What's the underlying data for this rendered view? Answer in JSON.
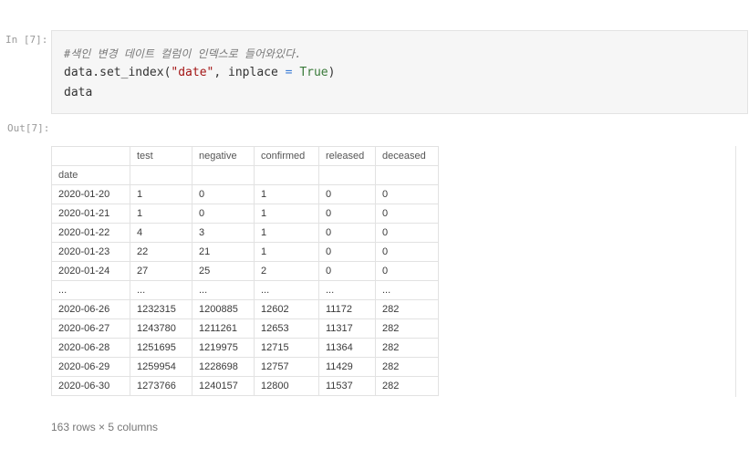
{
  "input_prompt": "In [7]:",
  "output_prompt": "Out[7]:",
  "code": {
    "comment": "#색인 변경 데이트 컬럼이 인덱스로 들어와있다.",
    "line1": {
      "prefix": "data.set_index(",
      "string": "\"date\"",
      "middle": ", inplace ",
      "operator": "=",
      "space": " ",
      "keyword": "True",
      "suffix": ")"
    },
    "line2": "data"
  },
  "table": {
    "columns": [
      "test",
      "negative",
      "confirmed",
      "released",
      "deceased"
    ],
    "index_name": "date",
    "rows": [
      [
        "2020-01-20",
        "1",
        "0",
        "1",
        "0",
        "0"
      ],
      [
        "2020-01-21",
        "1",
        "0",
        "1",
        "0",
        "0"
      ],
      [
        "2020-01-22",
        "4",
        "3",
        "1",
        "0",
        "0"
      ],
      [
        "2020-01-23",
        "22",
        "21",
        "1",
        "0",
        "0"
      ],
      [
        "2020-01-24",
        "27",
        "25",
        "2",
        "0",
        "0"
      ],
      [
        "...",
        "...",
        "...",
        "...",
        "...",
        "..."
      ],
      [
        "2020-06-26",
        "1232315",
        "1200885",
        "12602",
        "11172",
        "282"
      ],
      [
        "2020-06-27",
        "1243780",
        "1211261",
        "12653",
        "11317",
        "282"
      ],
      [
        "2020-06-28",
        "1251695",
        "1219975",
        "12715",
        "11364",
        "282"
      ],
      [
        "2020-06-29",
        "1259954",
        "1228698",
        "12757",
        "11429",
        "282"
      ],
      [
        "2020-06-30",
        "1273766",
        "1240157",
        "12800",
        "11537",
        "282"
      ]
    ]
  },
  "shape_text": "163 rows × 5 columns"
}
